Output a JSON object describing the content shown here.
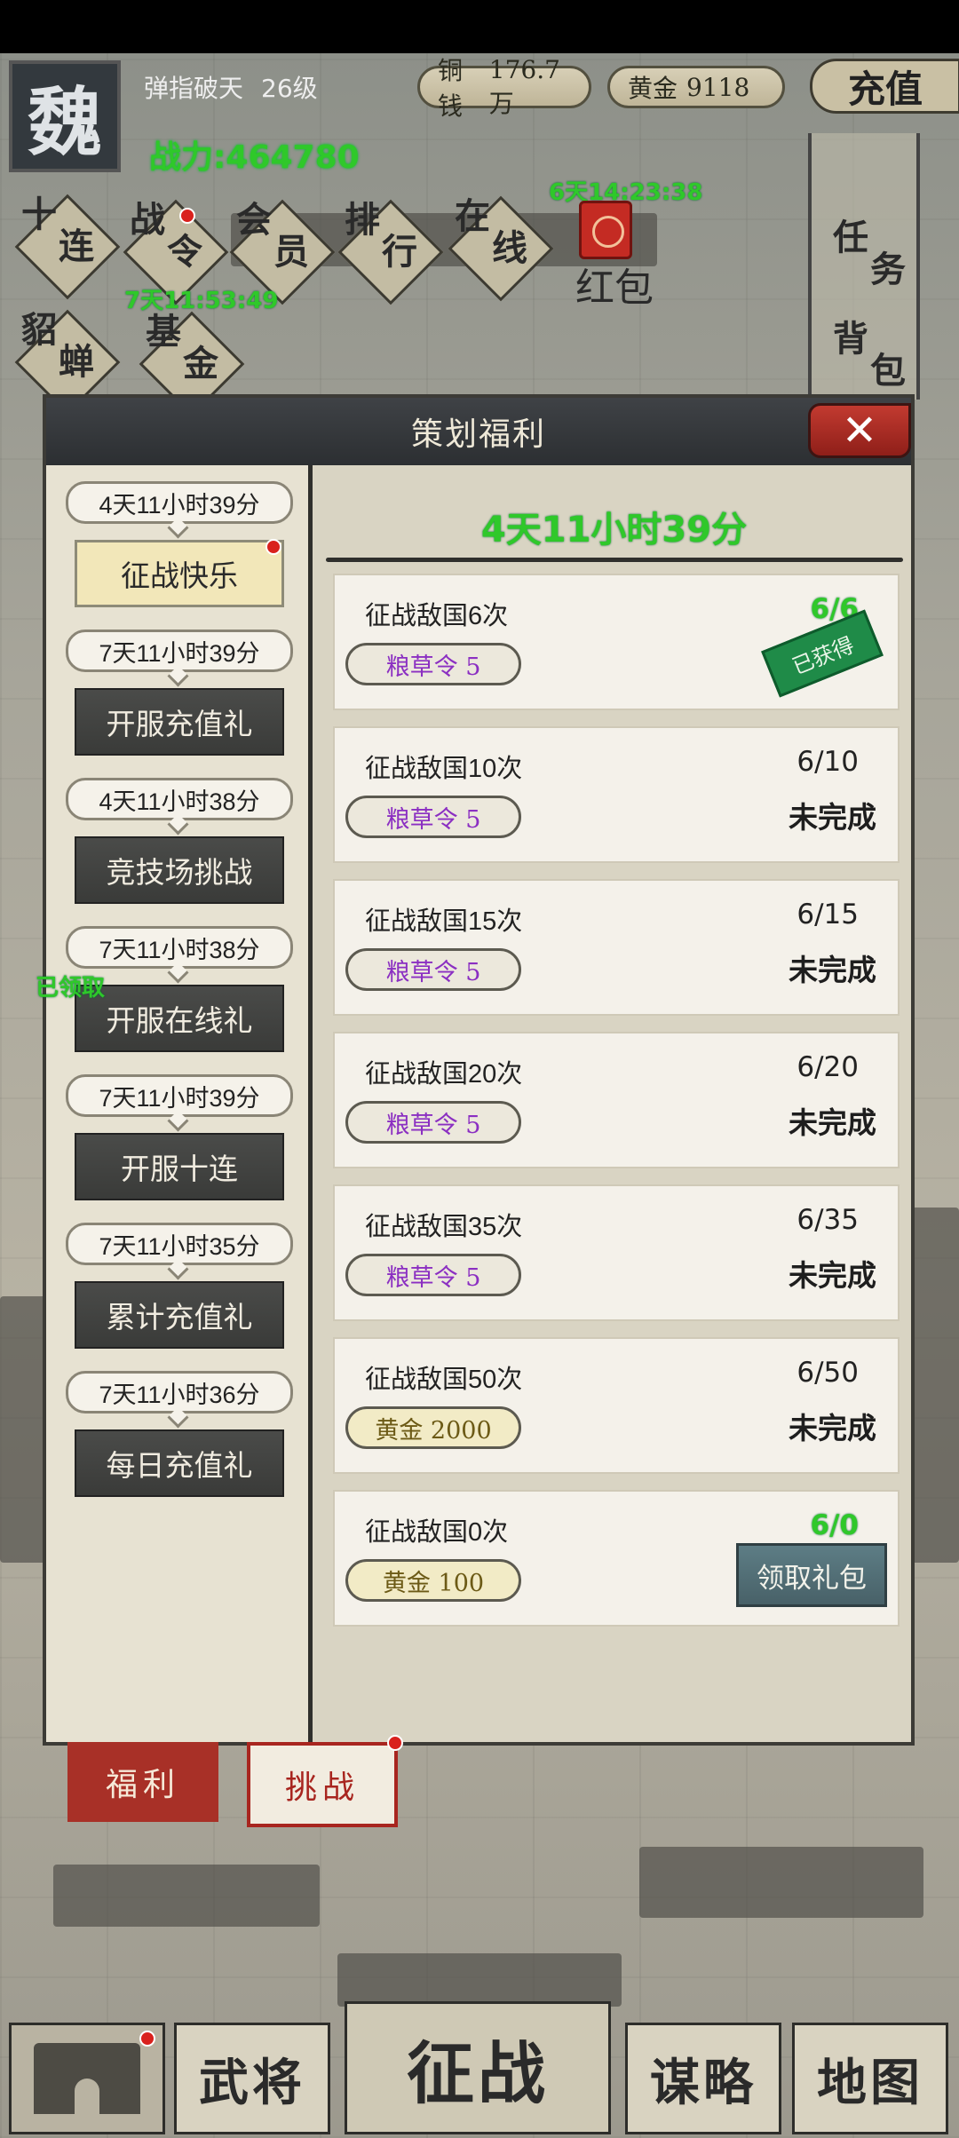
{
  "hud": {
    "kingdom": "魏",
    "player_name": "弹指破天",
    "player_level": "26级",
    "power": "战力:464780",
    "copper_label": "铜钱",
    "copper_value": "176.7万",
    "gold_label": "黄金",
    "gold_value": "9118",
    "recharge_label": "充值"
  },
  "top_nav": {
    "ten_pull": [
      "十",
      "连"
    ],
    "battle_pass": [
      "战",
      "令"
    ],
    "vip": [
      "会",
      "员"
    ],
    "ranking": [
      "排",
      "行"
    ],
    "online": [
      "在",
      "线"
    ],
    "marten_cicada": [
      "貂",
      "蝉"
    ],
    "fund": [
      "基",
      "金"
    ],
    "tasks": [
      "任",
      "务"
    ],
    "bag": [
      "背",
      "包"
    ],
    "red_packet_label": "红包",
    "red_packet_timer": "6天14:23:38",
    "fund_timer": "7天11:53:49"
  },
  "panel": {
    "title": "策划福利",
    "close_icon": "close-x-icon",
    "content_timer": "4天11小时39分"
  },
  "sidebar": {
    "items": [
      {
        "timer": "4天11小时39分",
        "label": "征战快乐"
      },
      {
        "timer": "7天11小时39分",
        "label": "开服充值礼"
      },
      {
        "timer": "4天11小时38分",
        "label": "竞技场挑战"
      },
      {
        "timer": "7天11小时38分",
        "label": "开服在线礼"
      },
      {
        "timer": "7天11小时39分",
        "label": "开服十连"
      },
      {
        "timer": "7天11小时35分",
        "label": "累计充值礼"
      },
      {
        "timer": "7天11小时36分",
        "label": "每日充值礼"
      }
    ],
    "claimed_tag": "已领取"
  },
  "tasks": [
    {
      "name": "征战敌国6次",
      "reward": "粮草令 5",
      "progress": "6/6",
      "status": "已获得"
    },
    {
      "name": "征战敌国10次",
      "reward": "粮草令 5",
      "progress": "6/10",
      "status": "未完成"
    },
    {
      "name": "征战敌国15次",
      "reward": "粮草令 5",
      "progress": "6/15",
      "status": "未完成"
    },
    {
      "name": "征战敌国20次",
      "reward": "粮草令 5",
      "progress": "6/20",
      "status": "未完成"
    },
    {
      "name": "征战敌国35次",
      "reward": "粮草令 5",
      "progress": "6/35",
      "status": "未完成"
    },
    {
      "name": "征战敌国50次",
      "reward": "黄金 2000",
      "progress": "6/50",
      "status": "未完成"
    },
    {
      "name": "征战敌国0次",
      "reward": "黄金 100",
      "progress": "6/0",
      "status": "领取礼包"
    }
  ],
  "tabs": {
    "welfare": "福利",
    "challenge": "挑战"
  },
  "bottom_nav": {
    "generals": "武将",
    "march": "征战",
    "strategy": "谋略",
    "map": "地图"
  },
  "colors": {
    "accent_green": "#2fc82a",
    "panel_bg": "#d9d4c3",
    "close_red": "#c23a30",
    "grain_purple": "#8b2fc2"
  }
}
